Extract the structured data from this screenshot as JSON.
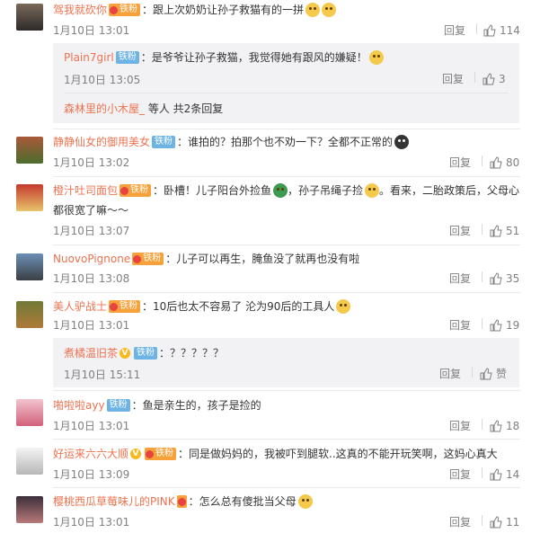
{
  "colors": {
    "username": "#eb7350",
    "meta": "#808080",
    "fan_badge": "#6db3e4",
    "crown_badge": "#f7a13a",
    "reply_bg": "#f2f2f5"
  },
  "comments": [
    {
      "username": "驾我就砍你",
      "badge_crown": "铁粉",
      "text": "：跟上次奶奶让孙子救猫有的一拼",
      "emoji": [
        "doge-icon",
        "doge-icon"
      ],
      "time": "1月10日 13:01",
      "reply_label": "回复",
      "likes": "114",
      "replies": [
        {
          "username": "Plain7girl",
          "badge_fan": "铁粉",
          "text": "：是爷爷让孙子救猫，我觉得她有跟风的嫌疑！",
          "emoji": [
            "glasses-face-icon"
          ],
          "time": "1月10日 13:05",
          "reply_label": "回复",
          "likes": "3"
        }
      ],
      "more": {
        "user": "森林里的小木屋_",
        "suffix": " 等人 ",
        "link": "共2条回复"
      }
    },
    {
      "username": "静静仙女的御用美女",
      "badge_fan": "铁粉",
      "text": "：谁拍的？拍那个也不劝一下？全都不正常的",
      "emoji": [
        "dark-face-icon"
      ],
      "time": "1月10日 13:02",
      "reply_label": "回复",
      "likes": "80"
    },
    {
      "username": "橙汁吐司面包",
      "badge_crown": "铁粉",
      "text": "：卧槽！儿子阳台外捡鱼",
      "text2": "，孙子吊绳子捡",
      "text3": "。看来，二胎政策后，父母心",
      "text_line2": "都很宽了嘛～～",
      "time": "1月10日 13:07",
      "reply_label": "回复",
      "likes": "51"
    },
    {
      "username": "NuovoPignone",
      "badge_crown": "铁粉",
      "text": "：儿子可以再生，腌鱼没了就再也没有啦",
      "time": "1月10日 13:08",
      "reply_label": "回复",
      "likes": "35"
    },
    {
      "username": "美人驴战士",
      "badge_crown": "铁粉",
      "text": "：10后也太不容易了 沦为90后的工具人",
      "emoji": [
        "sweat-face-icon"
      ],
      "time": "1月10日 13:01",
      "reply_label": "回复",
      "likes": "19",
      "replies": [
        {
          "username": "煮橘温旧茶",
          "vbadge": "V",
          "badge_fan": "铁粉",
          "text": "：？？？？？",
          "time": "1月10日 15:11",
          "reply_label": "回复",
          "likes": "赞"
        }
      ]
    },
    {
      "username": "啪啦啦ayy",
      "badge_fan": "铁粉",
      "text": "：鱼是亲生的，孩子是捡的",
      "time": "1月10日 13:01",
      "reply_label": "回复",
      "likes": "18"
    },
    {
      "username": "好运来六六大顺",
      "vbadge": "V",
      "badge_crown": "铁粉",
      "text": "：同是做妈妈的，我被吓到腿软..这真的不能开玩笑啊，这妈心真大",
      "time": "1月10日 13:09",
      "reply_label": "回复",
      "likes": "14"
    },
    {
      "username": "樱桃西瓜草莓味儿的PINK",
      "badge_crown_only": true,
      "text": "：怎么总有傻批当父母",
      "emoji": [
        "grin-face-icon"
      ],
      "time": "1月10日 13:01",
      "reply_label": "回复",
      "likes": "11"
    }
  ]
}
